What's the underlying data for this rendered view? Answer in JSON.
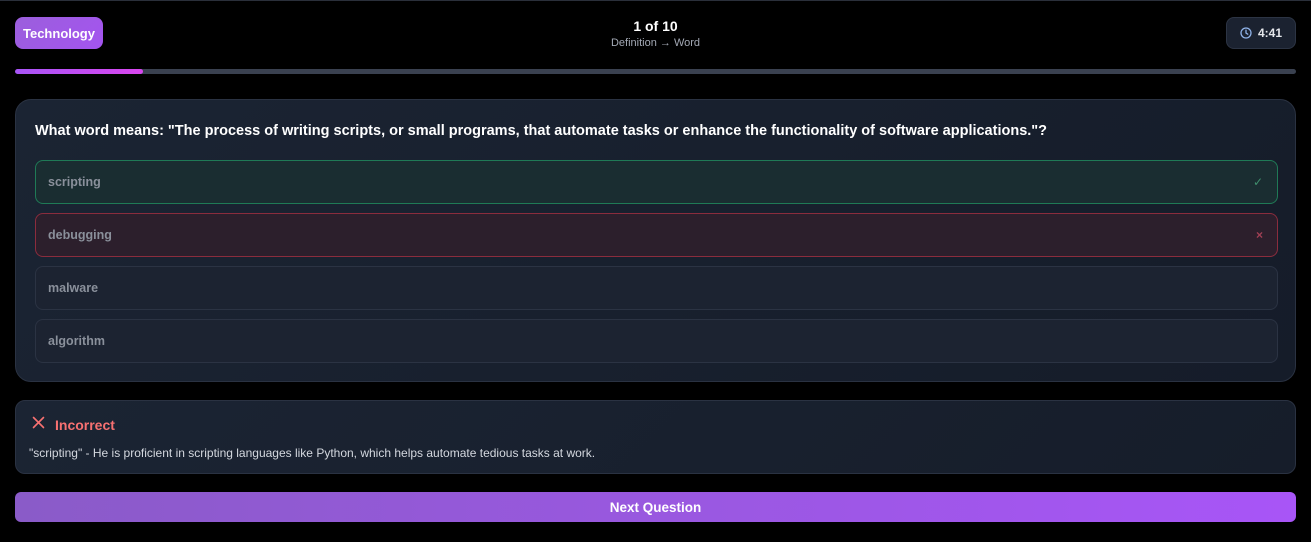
{
  "header": {
    "category": "Technology",
    "counter": "1 of 10",
    "mode": "Definition → Word",
    "timer": "4:41"
  },
  "progress": {
    "fraction": 0.1
  },
  "question": {
    "text": "What word means: \"The process of writing scripts, or small programs, that automate tasks or enhance the functionality of software applications.\"?",
    "options": [
      {
        "label": "scripting",
        "state": "correct",
        "mark": "✓"
      },
      {
        "label": "debugging",
        "state": "wrong",
        "mark": "×"
      },
      {
        "label": "malware",
        "state": "neutral",
        "mark": ""
      },
      {
        "label": "algorithm",
        "state": "neutral",
        "mark": ""
      }
    ]
  },
  "feedback": {
    "title": "Incorrect",
    "text": "\"scripting\" - He is proficient in scripting languages like Python, which helps automate tedious tasks at work."
  },
  "next_button": {
    "label": "Next Question"
  },
  "colors": {
    "accent": "#a855f7",
    "correct": "#1f7a56",
    "wrong": "#8b2c3d",
    "incorrect_text": "#f87171"
  }
}
